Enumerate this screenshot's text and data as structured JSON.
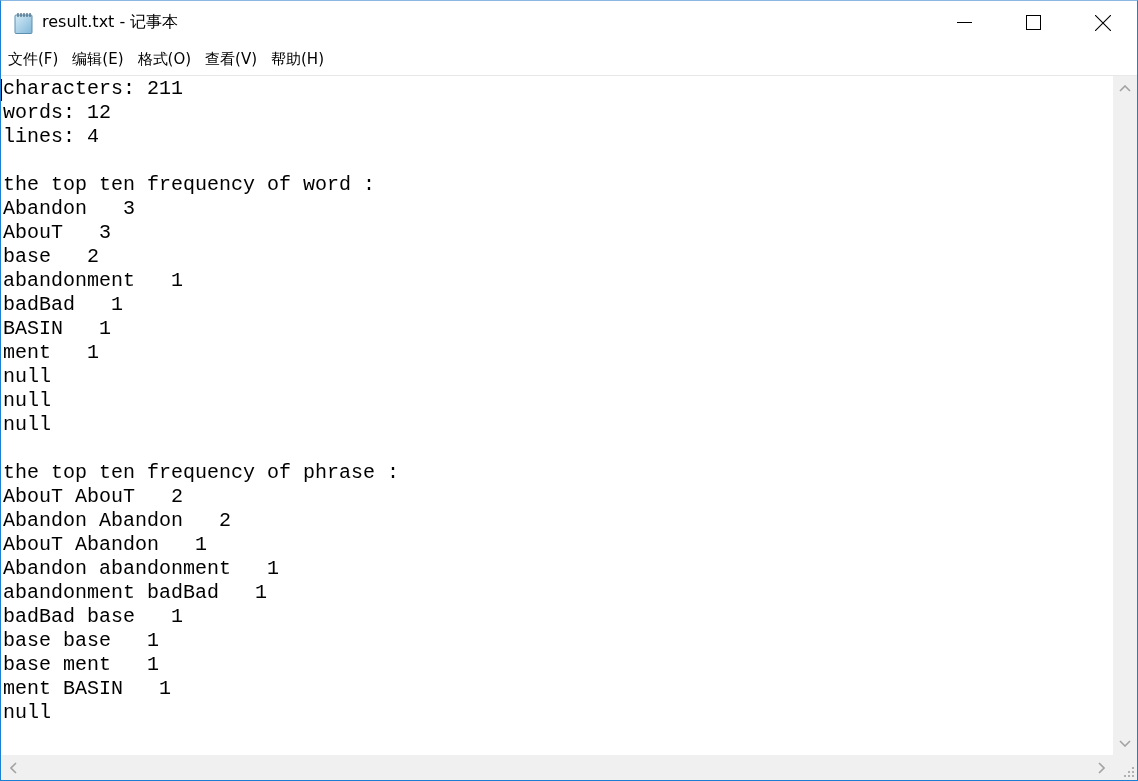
{
  "window": {
    "title": "result.txt - 记事本"
  },
  "menu_bar": [
    "文件(F)",
    "编辑(E)",
    "格式(O)",
    "查看(V)",
    "帮助(H)"
  ],
  "document": {
    "paragraphs": [
      [
        "characters: 211",
        "words: 12",
        "lines: 4"
      ],
      [
        "the top ten frequency of word :",
        "Abandon   3",
        "AbouT   3",
        "base   2",
        "abandonment   1",
        "badBad   1",
        "BASIN   1",
        "ment   1",
        "null",
        "null",
        "null"
      ],
      [
        "the top ten frequency of phrase :",
        "AbouT AbouT   2",
        "Abandon Abandon   2",
        "AbouT Abandon   1",
        "Abandon abandonment   1",
        "abandonment badBad   1",
        "badBad base   1",
        "base base   1",
        "base ment   1",
        "ment BASIN   1",
        "null"
      ]
    ]
  }
}
